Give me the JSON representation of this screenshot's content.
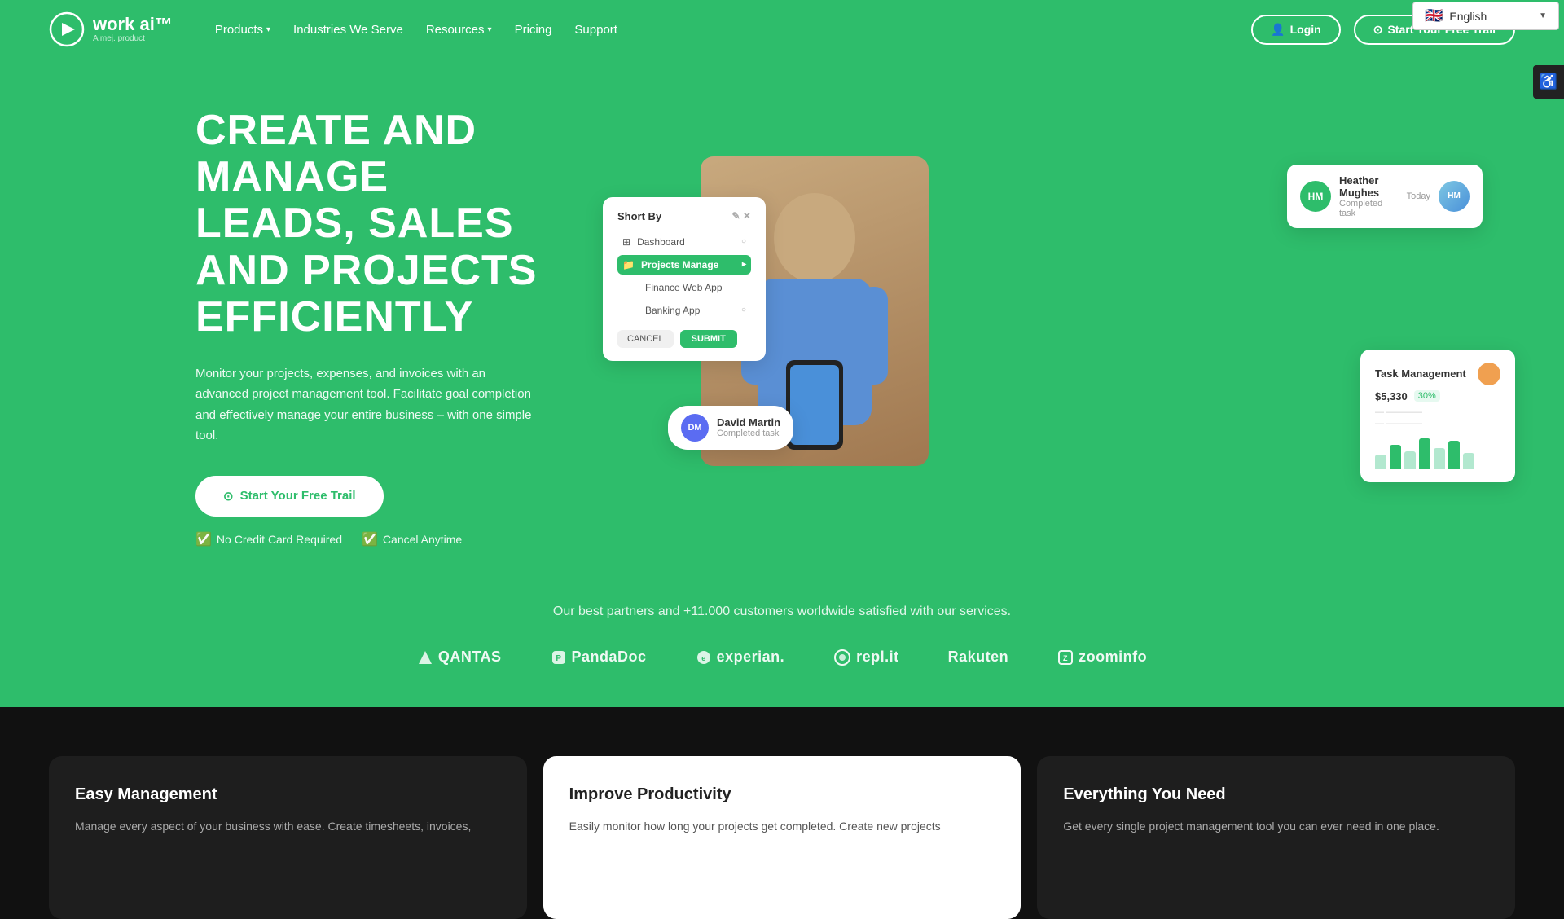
{
  "lang": {
    "flag": "🇬🇧",
    "label": "English",
    "chevron": "▼"
  },
  "accessibility": {
    "icon": "♿"
  },
  "nav": {
    "logo_text": "work ai™",
    "logo_sub": "A mej. product",
    "links": [
      {
        "id": "products",
        "label": "Products",
        "has_arrow": true
      },
      {
        "id": "industries",
        "label": "Industries We Serve",
        "has_arrow": false
      },
      {
        "id": "resources",
        "label": "Resources",
        "has_arrow": true
      },
      {
        "id": "pricing",
        "label": "Pricing",
        "has_arrow": false
      },
      {
        "id": "support",
        "label": "Support",
        "has_arrow": false
      }
    ],
    "login_label": "Login",
    "trial_label": "Start Your Free Trail"
  },
  "hero": {
    "title": "CREATE AND MANAGE LEADS, SALES AND PROJECTS EFFICIENTLY",
    "description": "Monitor your projects, expenses, and invoices with an advanced project management tool. Facilitate goal completion and effectively manage your entire business – with one simple tool.",
    "trial_btn": "Start Your Free Trail",
    "badge1": "No Credit Card Required",
    "badge2": "Cancel Anytime"
  },
  "ui_cards": {
    "sort_by": {
      "title": "Short By",
      "items": [
        {
          "label": "Dashboard",
          "active": false
        },
        {
          "label": "Projects Manage",
          "active": true
        },
        {
          "label": "Finance Web App",
          "active": false
        },
        {
          "label": "Banking App",
          "active": false
        }
      ],
      "cancel": "CANCEL",
      "submit": "SUBMIT"
    },
    "heather": {
      "initials": "HM",
      "name": "Heather Mughes",
      "sub": "Completed task",
      "time": "Today"
    },
    "task": {
      "title": "Task Management",
      "amount": "$5,330",
      "pct": "30%"
    },
    "david": {
      "initials": "DM",
      "name": "David Martin",
      "sub": "Completed task"
    }
  },
  "partners": {
    "title": "Our best partners and +11.000 customers worldwide satisfied with our services.",
    "logos": [
      {
        "id": "qantas",
        "name": "QANTAS"
      },
      {
        "id": "pandadoc",
        "name": "PandaDoc"
      },
      {
        "id": "experian",
        "name": "experian."
      },
      {
        "id": "replit",
        "name": "repl.it"
      },
      {
        "id": "rakuten",
        "name": "Rakuten"
      },
      {
        "id": "zoominfo",
        "name": "zoominfo"
      }
    ]
  },
  "features": [
    {
      "id": "easy-management",
      "title": "Easy Management",
      "desc": "Manage every aspect of your business with ease. Create timesheets, invoices,",
      "highlighted": false
    },
    {
      "id": "improve-productivity",
      "title": "Improve Productivity",
      "desc": "Easily monitor how long your projects get completed. Create new projects",
      "highlighted": true
    },
    {
      "id": "everything-you-need",
      "title": "Everything You Need",
      "desc": "Get every single project management tool you can ever need in one place.",
      "highlighted": false
    }
  ]
}
